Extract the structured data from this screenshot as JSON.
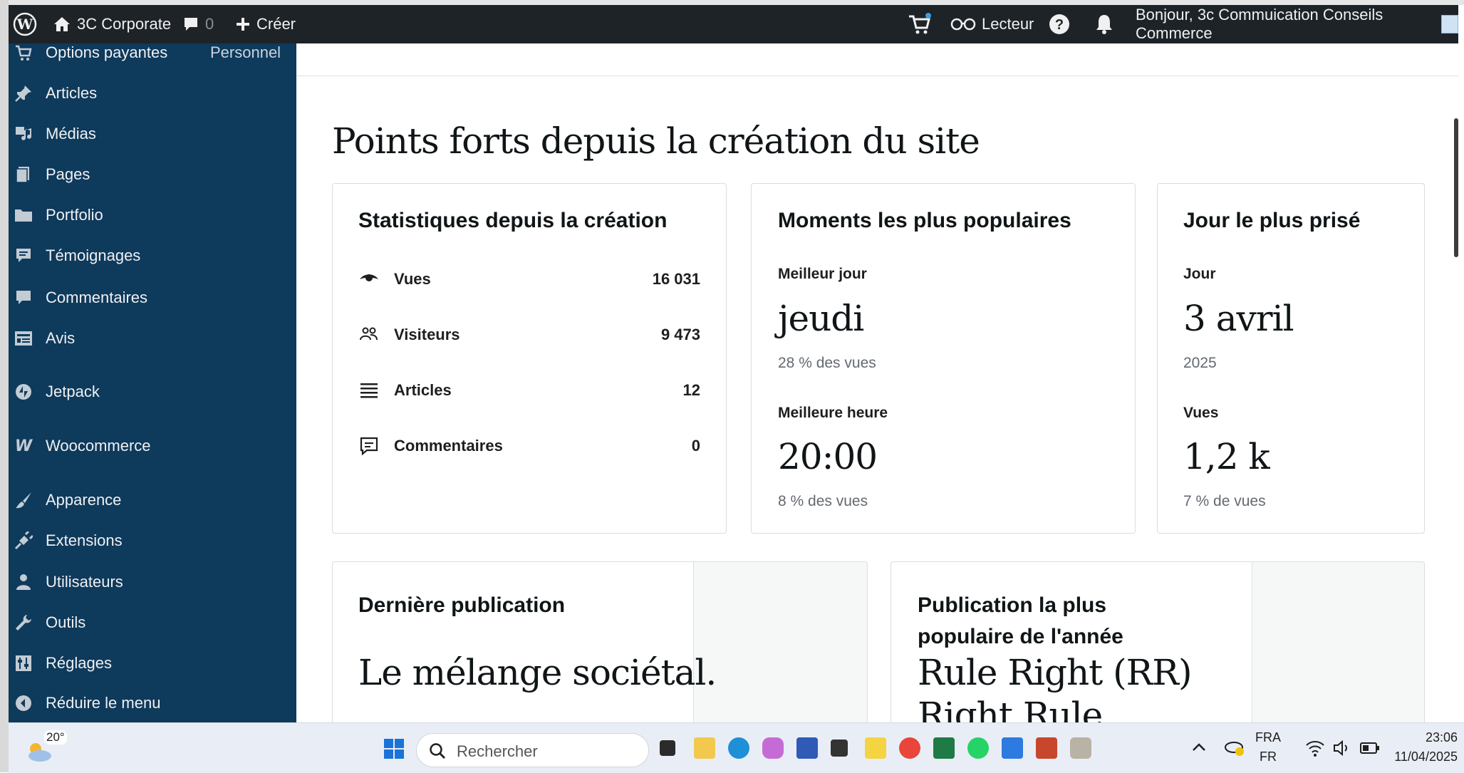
{
  "adminbar": {
    "site_name": "3C Corporate",
    "comments_count": "0",
    "create_label": "Créer",
    "reader_label": "Lecteur",
    "greeting": "Bonjour, 3c Commuication Conseils Commerce"
  },
  "sidebar": {
    "items": [
      {
        "label": "Options payantes",
        "extra": "Personnel",
        "icon": "cart-icon"
      },
      {
        "label": "Articles",
        "icon": "pin-icon"
      },
      {
        "label": "Médias",
        "icon": "media-icon"
      },
      {
        "label": "Pages",
        "icon": "pages-icon"
      },
      {
        "label": "Portfolio",
        "icon": "folder-icon"
      },
      {
        "label": "Témoignages",
        "icon": "testimonial-icon"
      },
      {
        "label": "Commentaires",
        "icon": "comment-icon"
      },
      {
        "label": "Avis",
        "icon": "feedback-icon"
      },
      {
        "label": "Jetpack",
        "icon": "jetpack-icon"
      },
      {
        "label": "Woocommerce",
        "icon": "woocommerce-icon"
      },
      {
        "label": "Apparence",
        "icon": "brush-icon"
      },
      {
        "label": "Extensions",
        "icon": "plugin-icon"
      },
      {
        "label": "Utilisateurs",
        "icon": "user-icon"
      },
      {
        "label": "Outils",
        "icon": "wrench-icon"
      },
      {
        "label": "Réglages",
        "icon": "settings-icon"
      },
      {
        "label": "Réduire le menu",
        "icon": "collapse-icon"
      }
    ]
  },
  "main": {
    "title": "Points forts depuis la création du site",
    "stats_card": {
      "title": "Statistiques depuis la création",
      "rows": [
        {
          "label": "Vues",
          "value": "16 031",
          "icon": "eye-icon"
        },
        {
          "label": "Visiteurs",
          "value": "9 473",
          "icon": "people-icon"
        },
        {
          "label": "Articles",
          "value": "12",
          "icon": "lines-icon"
        },
        {
          "label": "Commentaires",
          "value": "0",
          "icon": "comment-outline-icon"
        }
      ]
    },
    "popular_card": {
      "title": "Moments les plus populaires",
      "best_day_label": "Meilleur jour",
      "best_day_value": "jeudi",
      "best_day_note": "28 % des vues",
      "best_hour_label": "Meilleure heure",
      "best_hour_value": "20:00",
      "best_hour_note": "8 % des vues"
    },
    "top_day_card": {
      "title": "Jour le plus prisé",
      "day_label": "Jour",
      "day_value": "3 avril",
      "year": "2025",
      "views_label": "Vues",
      "views_value": "1,2 k",
      "views_note": "7 % de vues"
    },
    "latest_post_card": {
      "title": "Dernière publication",
      "post_title": "Le mélange sociétal."
    },
    "popular_post_card": {
      "title_line1": "Publication la plus",
      "title_line2": "populaire de l'année",
      "post_title_line1": "Rule Right (RR)",
      "post_title_line2": "Right Rule"
    }
  },
  "taskbar": {
    "weather_temp": "20°",
    "search_placeholder": "Rechercher",
    "lang_top": "FRA",
    "lang_bottom": "FR",
    "time": "23:06",
    "date": "11/04/2025"
  }
}
